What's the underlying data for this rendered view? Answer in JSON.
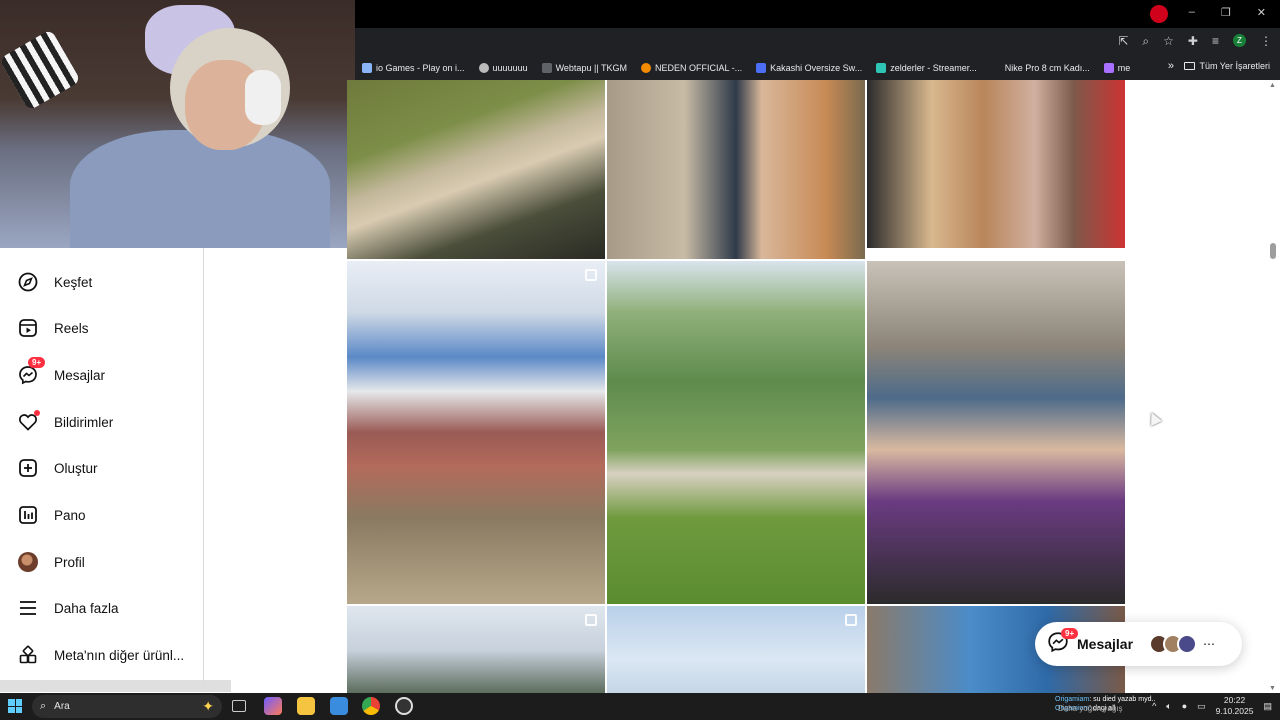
{
  "browser": {
    "bookmarks": [
      {
        "label": "io Games - Play on i...",
        "color": "#8ab4f8"
      },
      {
        "label": "uuuuuuu",
        "color": "#bbbbbb"
      },
      {
        "label": "Webtapu || TKGM",
        "color": "#5f6368"
      },
      {
        "label": "NEDEN OFFICIAL -...",
        "color": "#f28b00"
      },
      {
        "label": "Kakashi Oversize Sw...",
        "color": "#4c6ef5"
      },
      {
        "label": "zelderler - Streamer...",
        "color": "#2ec4b6"
      },
      {
        "label": "Nike Pro 8 cm Kadı...",
        "color": "#202124"
      },
      {
        "label": "me",
        "color": "#a970ff"
      }
    ],
    "all_bookmarks": "Tüm Yer İşaretleri",
    "profile_initial": "Z"
  },
  "sidebar": {
    "items": [
      {
        "label": "Keşfet",
        "icon": "compass-icon"
      },
      {
        "label": "Reels",
        "icon": "reels-icon"
      },
      {
        "label": "Mesajlar",
        "icon": "messenger-icon",
        "badge": "9+"
      },
      {
        "label": "Bildirimler",
        "icon": "heart-icon"
      },
      {
        "label": "Oluştur",
        "icon": "plus-square-icon"
      },
      {
        "label": "Pano",
        "icon": "dashboard-icon"
      },
      {
        "label": "Profil",
        "icon": "avatar"
      },
      {
        "label": "Daha fazla",
        "icon": "menu-icon"
      },
      {
        "label": "Meta'nın diğer ürünl...",
        "icon": "apps-icon"
      }
    ]
  },
  "messages_pill": {
    "label": "Mesajlar",
    "badge": "9+"
  },
  "taskbar": {
    "search_placeholder": "Ara",
    "ticker_line1_user": "Origamiam",
    "ticker_line1_text": ": su died yazab myd..",
    "ticker_line2_user": "Origamiam",
    "ticker_line2_text": ": dagi all",
    "weather": "Daha yoğun yağış",
    "time": "20:22",
    "date": "9.10.2025"
  },
  "colors": {
    "accent": "#ff3040",
    "chrome": "#202124"
  }
}
